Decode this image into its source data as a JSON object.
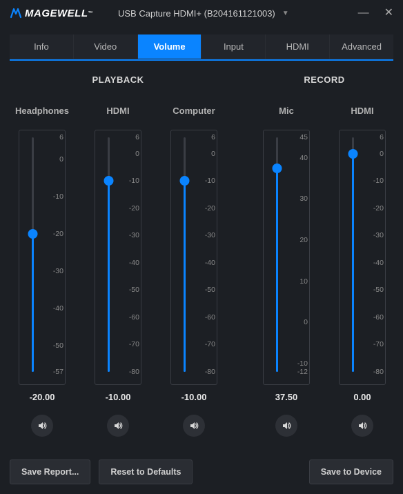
{
  "titlebar": {
    "brand": "MAGEWELL",
    "tm": "™",
    "device": "USB Capture HDMI+ (B204161121003)"
  },
  "tabs": {
    "items": [
      "Info",
      "Video",
      "Volume",
      "Input",
      "HDMI",
      "Advanced"
    ],
    "active": 2
  },
  "sections": {
    "playback": {
      "title": "PLAYBACK",
      "channels": [
        {
          "name": "Headphones",
          "value": "-20.00",
          "num": -20,
          "min": -57,
          "max": 6,
          "ticks": [
            6,
            0,
            -10,
            -20,
            -30,
            -40,
            -50,
            -57
          ]
        },
        {
          "name": "HDMI",
          "value": "-10.00",
          "num": -10,
          "min": -80,
          "max": 6,
          "ticks": [
            6,
            0,
            -10,
            -20,
            -30,
            -40,
            -50,
            -60,
            -70,
            -80
          ]
        },
        {
          "name": "Computer",
          "value": "-10.00",
          "num": -10,
          "min": -80,
          "max": 6,
          "ticks": [
            6,
            0,
            -10,
            -20,
            -30,
            -40,
            -50,
            -60,
            -70,
            -80
          ]
        }
      ]
    },
    "record": {
      "title": "RECORD",
      "channels": [
        {
          "name": "Mic",
          "value": "37.50",
          "num": 37.5,
          "min": -12,
          "max": 45,
          "ticks": [
            45,
            40,
            30,
            20,
            10,
            0,
            -10,
            -12
          ]
        },
        {
          "name": "HDMI",
          "value": "0.00",
          "num": 0,
          "min": -80,
          "max": 6,
          "ticks": [
            6,
            0,
            -10,
            -20,
            -30,
            -40,
            -50,
            -60,
            -70,
            -80
          ]
        }
      ]
    }
  },
  "footer": {
    "saveReport": "Save Report...",
    "reset": "Reset to Defaults",
    "saveDevice": "Save to Device"
  }
}
